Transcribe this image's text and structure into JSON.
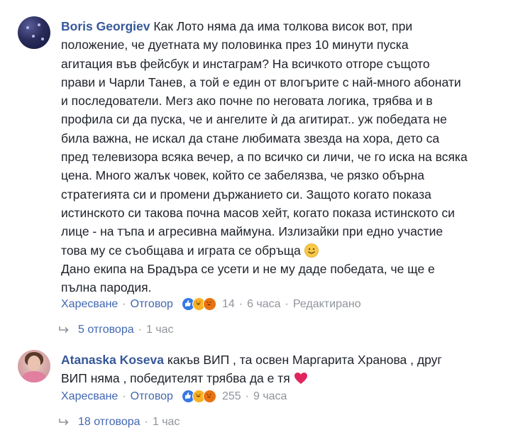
{
  "comments": [
    {
      "author": "Boris Georgiev",
      "lines": [
        "Как Лото няма да има толкова висок вот, при",
        "положение, че дуетната му половинка през 10 минути пуска",
        "агитация във фейсбук и инстаграм? На всичкото отгоре същото",
        "прави и Чарли Танев, а той е един от влогърите с най-много абонати",
        "и последователи. Мегз ако почне по неговата логика, трябва и в",
        "профила си да пуска, че и ангелите ѝ да агитират.. уж победата не",
        "била важна, не искал да стане любимата звезда на хора, дето са",
        "пред телевизора всяка вечер, а по всичко си личи, че го иска на всяка",
        "цена. Много жалък човек, който се забелязва, че рязко обърна",
        "стратегията си и промени държанието си. Защото когато показа",
        "истинското си такова почна масов хейт, когато показа истинското си",
        "лице - на тъпа и агресивна маймуна. Излизайки при едно участие",
        "това му се съобщава и играта се обръща"
      ],
      "para2_lines": [
        "Дано екипа на Брадъра се усети и не му даде победата, че ще е",
        "пълна пародия."
      ],
      "like_label": "Харесване",
      "reply_label": "Отговор",
      "reaction_count": "14",
      "time": "6 часа",
      "edited": "Редактирано",
      "replies_count": "5 отговора",
      "replies_time": "1 час",
      "reactions": [
        "like-icon",
        "haha-icon",
        "angry-icon"
      ]
    },
    {
      "author": "Atanaska Koseva",
      "line1": "какъв ВИП , та освен Маргарита Хранова , друг",
      "line2": "ВИП няма , победителят трябва да е тя",
      "like_label": "Харесване",
      "reply_label": "Отговор",
      "reaction_count": "255",
      "time": "9 часа",
      "replies_count": "18 отговора",
      "replies_time": "1 час",
      "reactions": [
        "like-icon",
        "haha-icon",
        "angry-icon"
      ]
    }
  ],
  "colors": {
    "author": "#365899",
    "link": "#4267b2",
    "meta": "#90949c",
    "heart": "#e0245e",
    "smile": "#f7c948"
  }
}
